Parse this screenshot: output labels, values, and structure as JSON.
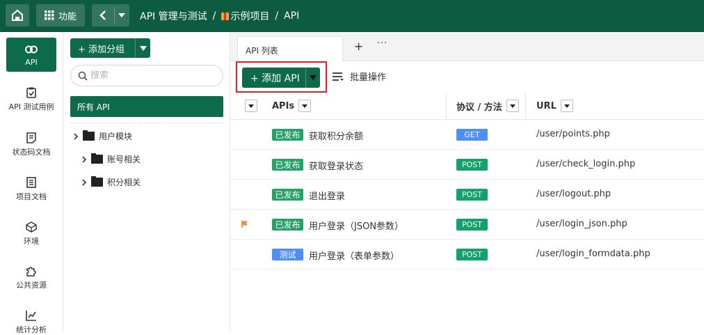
{
  "colors": {
    "brand": "#0d5b41",
    "accent": "#0d6b4a",
    "published": "#25a266",
    "testing": "#4e8ef7",
    "get": "#4e8ef7",
    "post": "#12a26a",
    "highlight": "#e02020",
    "flag": "#f08d2e"
  },
  "topbar": {
    "func_label": "功能",
    "breadcrumb": {
      "part1": "API 管理与测试",
      "sep1": "/",
      "part2": "示例项目",
      "sep2": "/",
      "part3": "API"
    }
  },
  "rail": {
    "items": [
      {
        "label": "API",
        "icon": "link-icon"
      },
      {
        "label": "API 测试用例",
        "icon": "clipboard-check-icon"
      },
      {
        "label": "状态码文档",
        "icon": "document-icon"
      },
      {
        "label": "项目文档",
        "icon": "list-document-icon"
      },
      {
        "label": "环境",
        "icon": "cube-icon"
      },
      {
        "label": "公共资源",
        "icon": "puzzle-icon"
      },
      {
        "label": "统计分析",
        "icon": "chart-icon"
      }
    ]
  },
  "groups": {
    "add_label": "添加分组",
    "search_placeholder": "搜索",
    "all_label": "所有 API",
    "tree": [
      {
        "label": "用户模块"
      },
      {
        "label": "账号相关"
      },
      {
        "label": "积分相关"
      }
    ]
  },
  "tabs": {
    "active": "API 列表",
    "plus": "+",
    "more": "···"
  },
  "toolbar": {
    "add_api": "+ 添加 API",
    "batch": "批量操作"
  },
  "table": {
    "headers": {
      "apis": "APIs",
      "method": "协议 / 方法",
      "url": "URL"
    },
    "rows": [
      {
        "status": "已发布",
        "status_type": "published",
        "name": "获取积分余额",
        "method": "GET",
        "url": "/user/points.php",
        "flagged": false
      },
      {
        "status": "已发布",
        "status_type": "published",
        "name": "获取登录状态",
        "method": "POST",
        "url": "/user/check_login.php",
        "flagged": false
      },
      {
        "status": "已发布",
        "status_type": "published",
        "name": "退出登录",
        "method": "POST",
        "url": "/user/logout.php",
        "flagged": false
      },
      {
        "status": "已发布",
        "status_type": "published",
        "name": "用户登录（JSON参数）",
        "method": "POST",
        "url": "/user/login_json.php",
        "flagged": true
      },
      {
        "status": "测试",
        "status_type": "testing",
        "name": "用户登录（表单参数）",
        "method": "POST",
        "url": "/user/login_formdata.php",
        "flagged": false
      }
    ]
  }
}
